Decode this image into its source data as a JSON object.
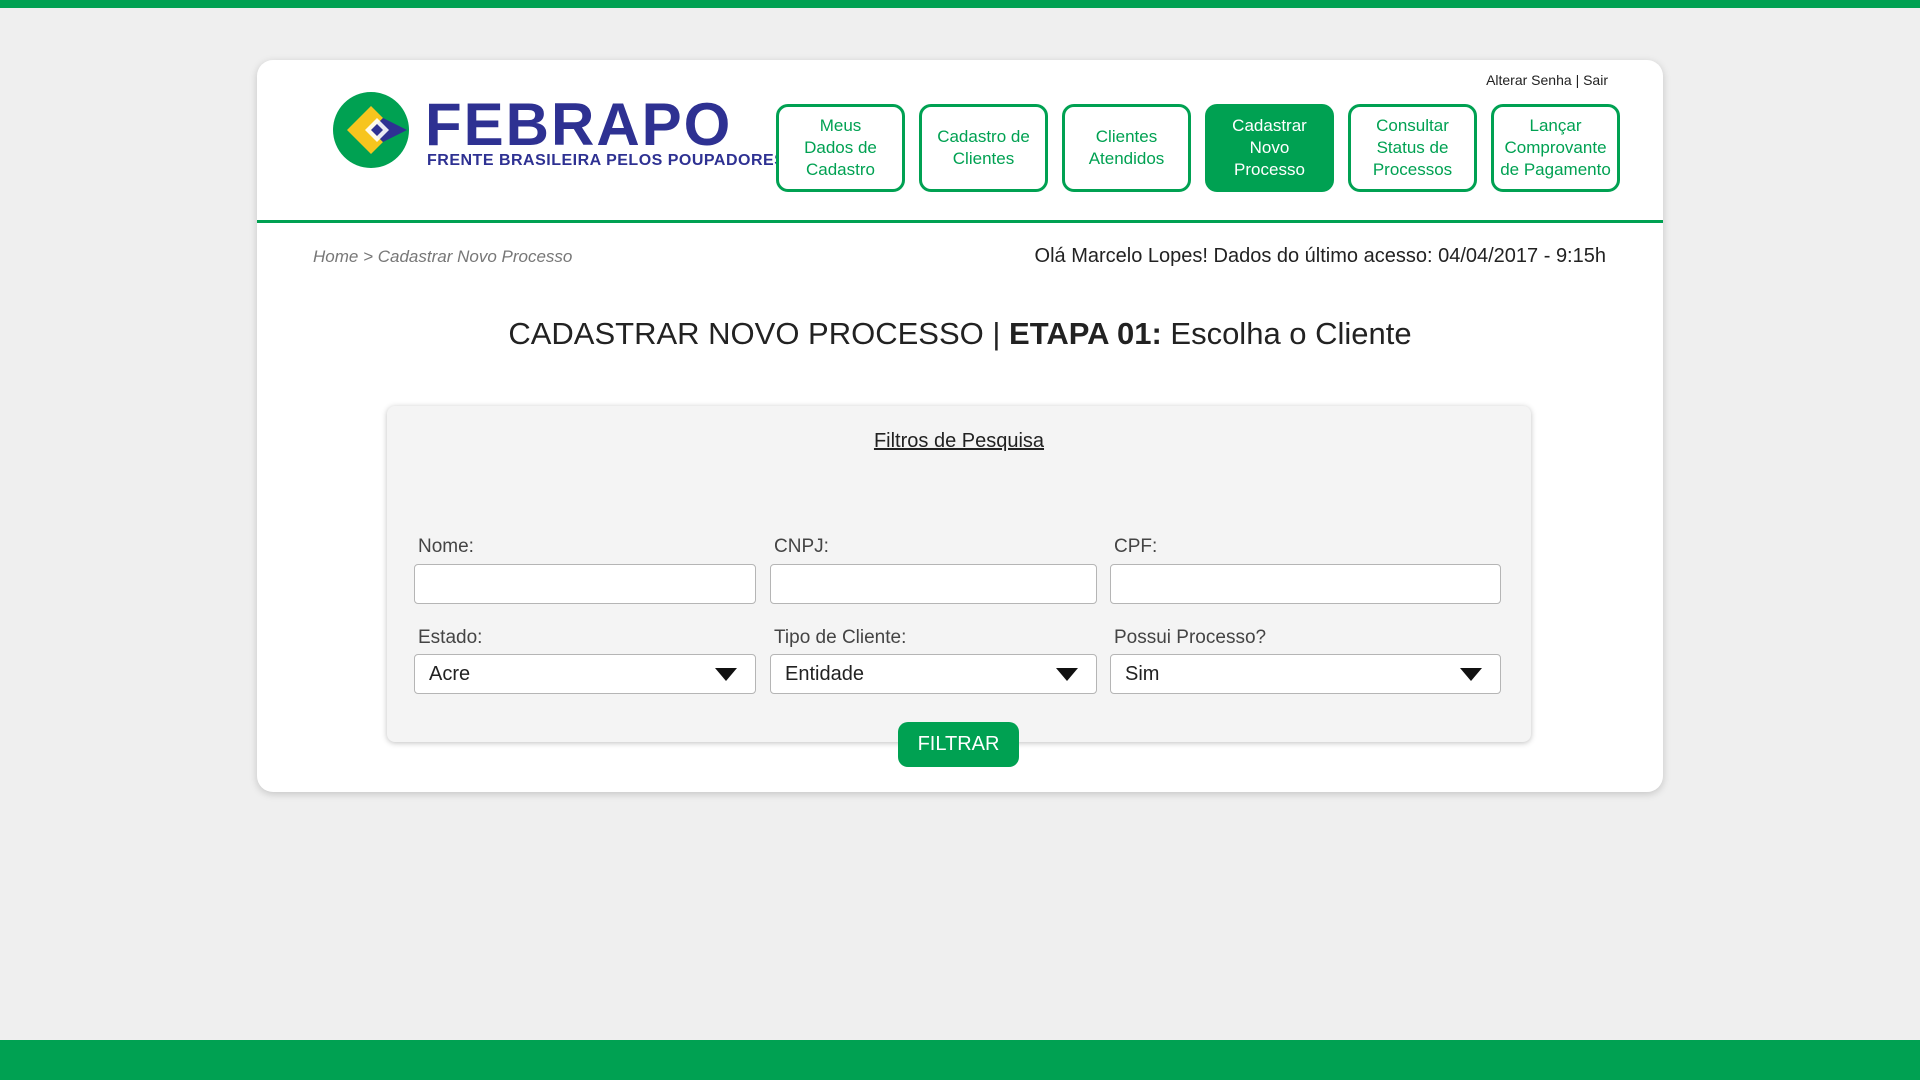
{
  "brand": {
    "name": "FEBRAPO",
    "tagline": "FRENTE BRASILEIRA PELOS POUPADORES",
    "colors": {
      "green": "#00a152",
      "navy": "#2e3192",
      "yellow": "#f7c51e"
    }
  },
  "toplinks": {
    "change_password": "Alterar Senha",
    "separator": "|",
    "logout": "Sair"
  },
  "nav": [
    {
      "label": "Meus\nDados de\nCadastro",
      "active": false
    },
    {
      "label": "Cadastro de\nClientes",
      "active": false
    },
    {
      "label": "Clientes\nAtendidos",
      "active": false
    },
    {
      "label": "Cadastrar\nNovo\nProcesso",
      "active": true
    },
    {
      "label": "Consultar\nStatus de\nProcessos",
      "active": false
    },
    {
      "label": "Lançar\nComprovante\nde Pagamento",
      "active": false
    }
  ],
  "breadcrumb": "Home > Cadastrar Novo Processo",
  "greeting": "Olá Marcelo Lopes! Dados do último acesso: 04/04/2017 - 9:15h",
  "title": {
    "main": "CADASTRAR NOVO PROCESSO | ",
    "step": "ETAPA 01:",
    "sub": " Escolha o Cliente"
  },
  "filters": {
    "heading": "Filtros de Pesquisa",
    "nome": {
      "label": "Nome:",
      "value": ""
    },
    "cnpj": {
      "label": "CNPJ:",
      "value": ""
    },
    "cpf": {
      "label": "CPF:",
      "value": ""
    },
    "estado": {
      "label": "Estado:",
      "selected": "Acre"
    },
    "tipo_cliente": {
      "label": "Tipo de Cliente:",
      "selected": "Entidade"
    },
    "possui_processo": {
      "label": "Possui Processo?",
      "selected": "Sim"
    },
    "submit_label": "FILTRAR"
  }
}
